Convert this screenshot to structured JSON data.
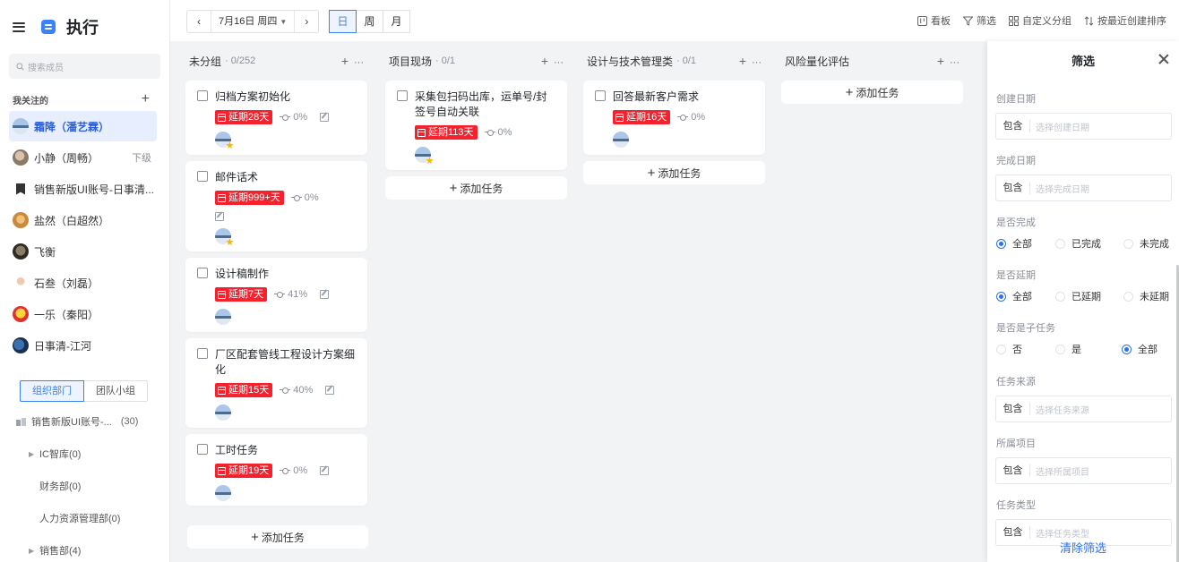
{
  "app": {
    "title": "执行"
  },
  "sidebar": {
    "search_placeholder": "搜索成员",
    "follow_title": "我关注的",
    "follow_add": "+",
    "members": [
      {
        "name": "霜降（潘艺霖）",
        "active": true,
        "sub": ""
      },
      {
        "name": "小静（周畅）",
        "active": false,
        "sub": "下级"
      },
      {
        "name": "销售新版UI账号-日事清...",
        "active": false,
        "sub": ""
      },
      {
        "name": "盐然（白超然）",
        "active": false,
        "sub": ""
      },
      {
        "name": "飞衡",
        "active": false,
        "sub": ""
      },
      {
        "name": "石叁（刘磊）",
        "active": false,
        "sub": ""
      },
      {
        "name": "一乐（秦阳）",
        "active": false,
        "sub": ""
      },
      {
        "name": "日事清-江河",
        "active": false,
        "sub": ""
      }
    ],
    "tabs": {
      "org": "组织部门",
      "team": "团队小组"
    },
    "org_root": {
      "name": "销售新版UI账号-...",
      "count": "(30)"
    },
    "departments": [
      {
        "name": "IC智库(0)",
        "expandable": true
      },
      {
        "name": "财务部(0)",
        "expandable": false
      },
      {
        "name": "人力资源管理部(0)",
        "expandable": false
      },
      {
        "name": "销售部(4)",
        "expandable": true
      }
    ]
  },
  "toolbar": {
    "prev": "‹",
    "next": "›",
    "date": "7月16日 周四",
    "periods": [
      "日",
      "周",
      "月"
    ],
    "active_period": "日",
    "tools": [
      "看板",
      "筛选",
      "自定义分组",
      "按最近创建排序"
    ]
  },
  "board": {
    "add_task_label": "添加任务",
    "columns": [
      {
        "name": "未分组",
        "count": "0/252",
        "cards": [
          {
            "title": "归档方案初始化",
            "delay": "延期28天",
            "progress": "0%"
          },
          {
            "title": "邮件话术",
            "delay": "延期999+天",
            "progress": "0%"
          },
          {
            "title": "设计稿制作",
            "delay": "延期7天",
            "progress": "41%"
          },
          {
            "title": "厂区配套管线工程设计方案细化",
            "delay": "延期15天",
            "progress": "40%"
          },
          {
            "title": "工时任务",
            "delay": "延期19天",
            "progress": "0%"
          }
        ]
      },
      {
        "name": "项目现场",
        "count": "0/1",
        "cards": [
          {
            "title": "采集包扫码出库，运单号/封签号自动关联",
            "delay": "延期113天",
            "progress": "0%"
          }
        ]
      },
      {
        "name": "设计与技术管理类",
        "count": "0/1",
        "cards": [
          {
            "title": "回答最新客户需求",
            "delay": "延期16天",
            "progress": "0%"
          }
        ]
      },
      {
        "name": "风险量化评估",
        "count": "",
        "cards": []
      }
    ]
  },
  "filter": {
    "title": "筛选",
    "op_label": "包含",
    "fields": [
      {
        "label": "创建日期",
        "placeholder": "选择创建日期"
      },
      {
        "label": "完成日期",
        "placeholder": "选择完成日期"
      }
    ],
    "radios": [
      {
        "label": "是否完成",
        "options": [
          "全部",
          "已完成",
          "未完成"
        ],
        "selected": "全部"
      },
      {
        "label": "是否延期",
        "options": [
          "全部",
          "已延期",
          "未延期"
        ],
        "selected": "全部"
      },
      {
        "label": "是否是子任务",
        "options": [
          "否",
          "是",
          "全部"
        ],
        "selected": "全部"
      }
    ],
    "fields2": [
      {
        "label": "任务来源",
        "placeholder": "选择任务来源"
      },
      {
        "label": "所属项目",
        "placeholder": "选择所属项目"
      },
      {
        "label": "任务类型",
        "placeholder": "选择任务类型"
      }
    ],
    "clear_label": "清除筛选"
  },
  "colors": {
    "accent": "#3b82f6",
    "delay_tag": "#f5222d"
  }
}
